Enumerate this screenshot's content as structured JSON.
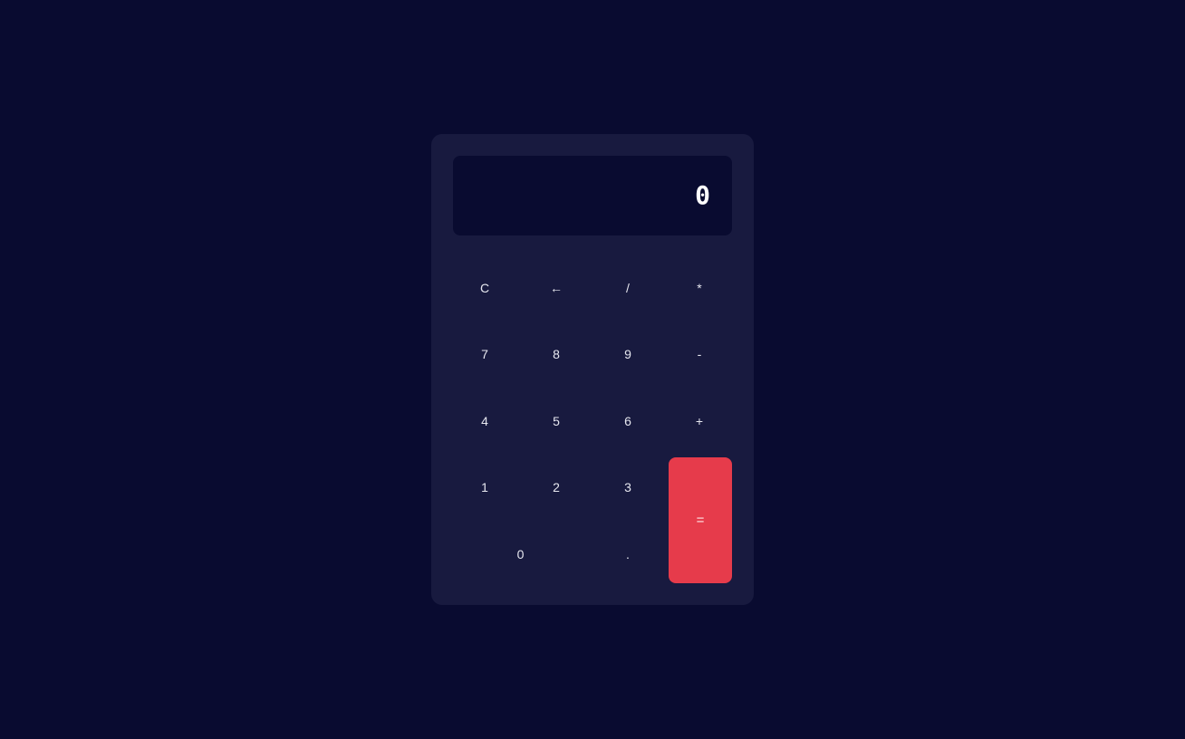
{
  "display": {
    "value": "0"
  },
  "keys": {
    "clear": "C",
    "backspace": "←",
    "divide": "/",
    "multiply": "*",
    "seven": "7",
    "eight": "8",
    "nine": "9",
    "subtract": "-",
    "four": "4",
    "five": "5",
    "six": "6",
    "add": "+",
    "one": "1",
    "two": "2",
    "three": "3",
    "zero": "0",
    "decimal": ".",
    "equals": "="
  },
  "colors": {
    "background": "#090b30",
    "panel": "#181a3f",
    "display": "#090b30",
    "accent": "#e63b4b",
    "text": "#ffffff"
  }
}
